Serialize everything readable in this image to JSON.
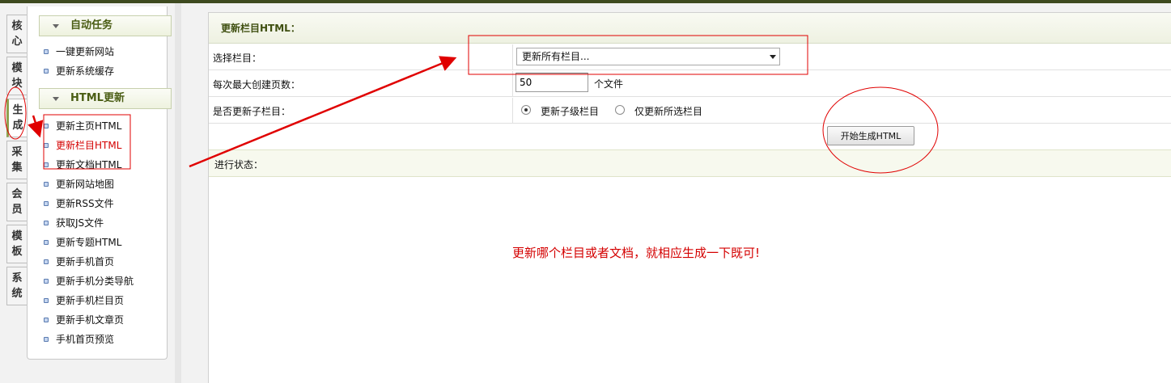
{
  "vertical_tabs": [
    {
      "label": "核心",
      "active": false
    },
    {
      "label": "模块",
      "active": false
    },
    {
      "label": "生成",
      "active": true
    },
    {
      "label": "采集",
      "active": false
    },
    {
      "label": "会员",
      "active": false
    },
    {
      "label": "模板",
      "active": false
    },
    {
      "label": "系统",
      "active": false
    }
  ],
  "menu": {
    "sections": [
      {
        "title": "自动任务",
        "items": [
          "一键更新网站",
          "更新系统缓存"
        ]
      },
      {
        "title": "HTML更新",
        "items": [
          "更新主页HTML",
          "更新栏目HTML",
          "更新文档HTML",
          "更新网站地图",
          "更新RSS文件",
          "获取JS文件",
          "更新专题HTML",
          "更新手机首页",
          "更新手机分类导航",
          "更新手机栏目页",
          "更新手机文章页",
          "手机首页预览"
        ]
      }
    ],
    "current_item": "更新栏目HTML"
  },
  "main": {
    "title": "更新栏目HTML：",
    "rows": {
      "select_label": "选择栏目：",
      "select_value": "更新所有栏目...",
      "pages_label": "每次最大创建页数：",
      "pages_value": "50",
      "pages_unit": "个文件",
      "sub_label": "是否更新子栏目：",
      "radio_1": "更新子级栏目",
      "radio_2": "仅更新所选栏目"
    },
    "start_button": "开始生成HTML",
    "status_label": "进行状态："
  },
  "annotation": {
    "note": "更新哪个栏目或者文档，就相应生成一下既可!",
    "color": "#e00000"
  }
}
